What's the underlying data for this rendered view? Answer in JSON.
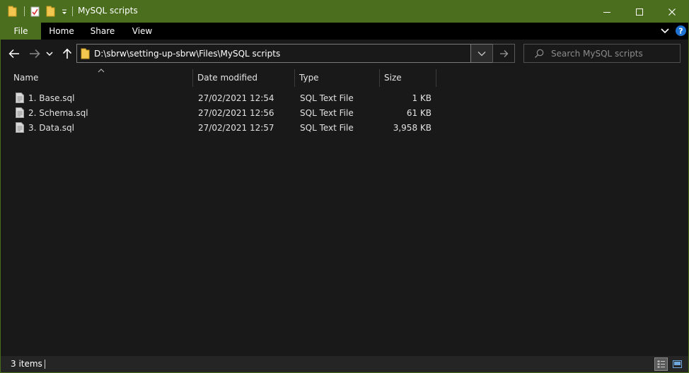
{
  "window": {
    "title": "MySQL scripts"
  },
  "ribbon": {
    "tabs": [
      "File",
      "Home",
      "Share",
      "View"
    ]
  },
  "address": {
    "path": "D:\\sbrw\\setting-up-sbrw\\Files\\MySQL scripts"
  },
  "search": {
    "placeholder": "Search MySQL scripts"
  },
  "columns": [
    "Name",
    "Date modified",
    "Type",
    "Size"
  ],
  "files": [
    {
      "name": "1. Base.sql",
      "date": "27/02/2021 12:54",
      "type": "SQL Text File",
      "size": "1 KB"
    },
    {
      "name": "2. Schema.sql",
      "date": "27/02/2021 12:56",
      "type": "SQL Text File",
      "size": "61 KB"
    },
    {
      "name": "3. Data.sql",
      "date": "27/02/2021 12:57",
      "type": "SQL Text File",
      "size": "3,958 KB"
    }
  ],
  "status": {
    "item_count": "3 items"
  },
  "colors": {
    "accent": "#4a6e1e",
    "background": "#191919",
    "folder": "#f3c64f"
  }
}
